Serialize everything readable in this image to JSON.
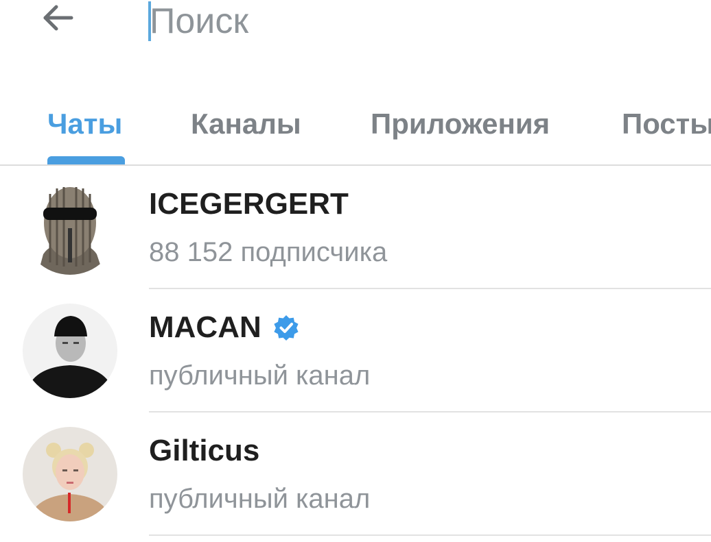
{
  "header": {
    "back_icon": "arrow-left-icon",
    "search_placeholder": "Поиск",
    "search_value": ""
  },
  "tabs": [
    {
      "label": "Чаты",
      "active": true
    },
    {
      "label": "Каналы",
      "active": false
    },
    {
      "label": "Приложения",
      "active": false
    },
    {
      "label": "Посты",
      "active": false
    }
  ],
  "colors": {
    "accent": "#4a9ee0",
    "caret": "#5ba8dd",
    "verified": "#3d9be9",
    "title_text": "#1f1f1f",
    "subtitle_text": "#8f9499",
    "inactive_tab": "#7d8287"
  },
  "results": [
    {
      "title": "ICEGERGERT",
      "subtitle": "88 152 подписчика",
      "verified": false,
      "avatar_icon": "avatar-balaclava"
    },
    {
      "title": "MACAN",
      "subtitle": "публичный канал",
      "verified": true,
      "avatar_icon": "avatar-beanie"
    },
    {
      "title": "Gilticus",
      "subtitle": "публичный канал",
      "verified": false,
      "avatar_icon": "avatar-blonde"
    }
  ]
}
